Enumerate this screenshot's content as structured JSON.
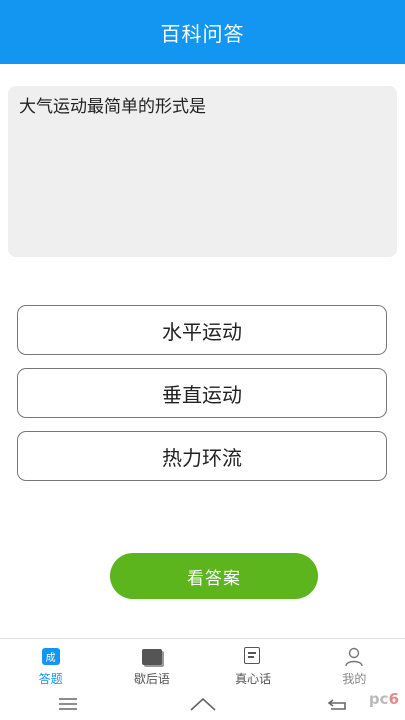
{
  "header": {
    "title": "百科问答"
  },
  "question": {
    "text": "大气运动最简单的形式是"
  },
  "options": [
    {
      "label": "水平运动"
    },
    {
      "label": "垂直运动"
    },
    {
      "label": "热力环流"
    }
  ],
  "answer_button": {
    "label": "看答案"
  },
  "tabbar": {
    "items": [
      {
        "label": "答题",
        "icon": "cheng-badge-icon",
        "icon_text": "成",
        "active": true
      },
      {
        "label": "歇后语",
        "icon": "book-icon"
      },
      {
        "label": "真心话",
        "icon": "note-icon"
      },
      {
        "label": "我的",
        "icon": "user-icon"
      }
    ]
  },
  "watermark": {
    "text_a": "pc",
    "text_b": "6"
  },
  "colors": {
    "primary": "#1296f2",
    "accent_green": "#5cb51c",
    "question_bg": "#efefef"
  }
}
